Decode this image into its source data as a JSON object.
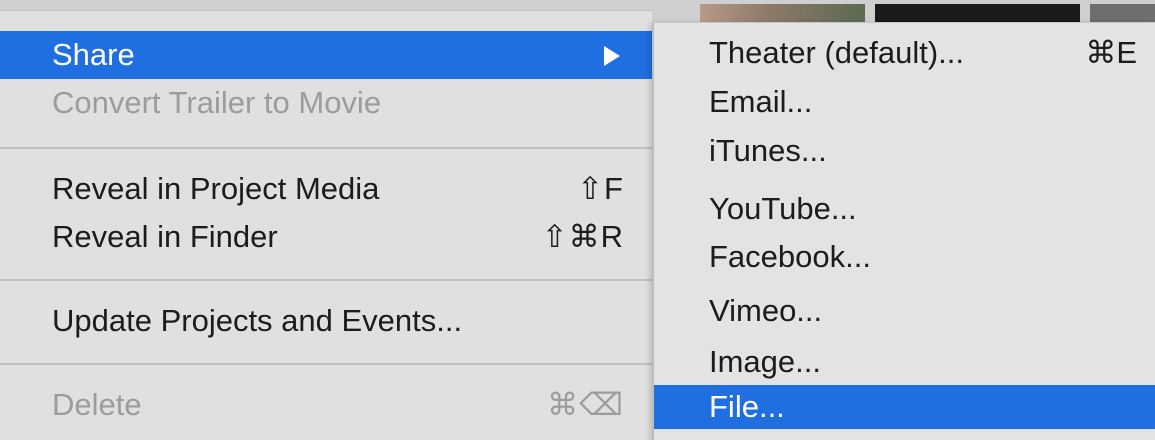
{
  "menu": {
    "items": [
      {
        "label": "Share",
        "shortcut": "",
        "state": "selected",
        "submenu_arrow": "right-triangle-icon"
      },
      {
        "label": "Convert Trailer to Movie",
        "shortcut": "",
        "state": "disabled"
      },
      {
        "label": "Reveal in Project Media",
        "shortcut": "⇧F",
        "state": "enabled"
      },
      {
        "label": "Reveal in Finder",
        "shortcut": "⇧⌘R",
        "state": "enabled"
      },
      {
        "label": "Update Projects and Events...",
        "shortcut": "",
        "state": "enabled"
      },
      {
        "label": "Delete",
        "shortcut": "⌘⌫",
        "state": "disabled"
      }
    ]
  },
  "submenu": {
    "items": [
      {
        "label": "Theater (default)...",
        "shortcut": "⌘E",
        "state": "enabled"
      },
      {
        "label": "Email...",
        "shortcut": "",
        "state": "enabled"
      },
      {
        "label": "iTunes...",
        "shortcut": "",
        "state": "enabled"
      },
      {
        "label": "YouTube...",
        "shortcut": "",
        "state": "enabled"
      },
      {
        "label": "Facebook...",
        "shortcut": "",
        "state": "enabled"
      },
      {
        "label": "Vimeo...",
        "shortcut": "",
        "state": "enabled"
      },
      {
        "label": "Image...",
        "shortcut": "",
        "state": "enabled"
      },
      {
        "label": "File...",
        "shortcut": "",
        "state": "selected"
      }
    ]
  },
  "colors": {
    "selection": "#1f6fe0",
    "menu_background": "#e0e0e0",
    "disabled_text": "#9c9c9c",
    "text": "#1c1c1c"
  }
}
